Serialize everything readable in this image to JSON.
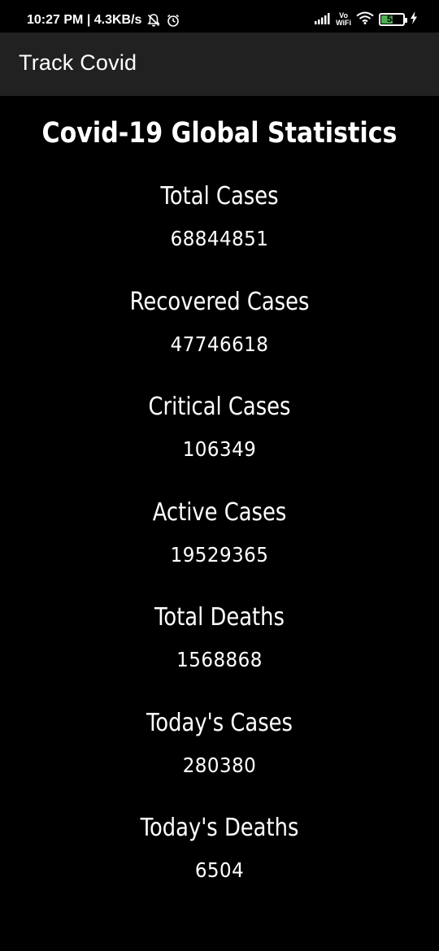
{
  "status_bar": {
    "time_and_speed": "10:27 PM | 4.3KB/s",
    "vowifi_top": "Vo",
    "vowifi_bottom": "WiFi",
    "battery_level": "58",
    "battery_fraction": 0.58,
    "battery_color": "#4caf50",
    "icons": [
      "mute-bell-icon",
      "alarm-icon",
      "signal-icon",
      "vowifi-icon",
      "wifi-icon",
      "battery-icon",
      "charging-icon"
    ]
  },
  "app_bar": {
    "title": "Track Covid",
    "background": "#212121"
  },
  "main": {
    "title": "Covid-19 Global Statistics",
    "stats": [
      {
        "label": "Total Cases",
        "value": "68844851"
      },
      {
        "label": "Recovered Cases",
        "value": "47746618"
      },
      {
        "label": "Critical Cases",
        "value": "106349"
      },
      {
        "label": "Active Cases",
        "value": "19529365"
      },
      {
        "label": "Total Deaths",
        "value": "1568868"
      },
      {
        "label": "Today's Cases",
        "value": "280380"
      },
      {
        "label": "Today's Deaths",
        "value": "6504"
      }
    ]
  }
}
